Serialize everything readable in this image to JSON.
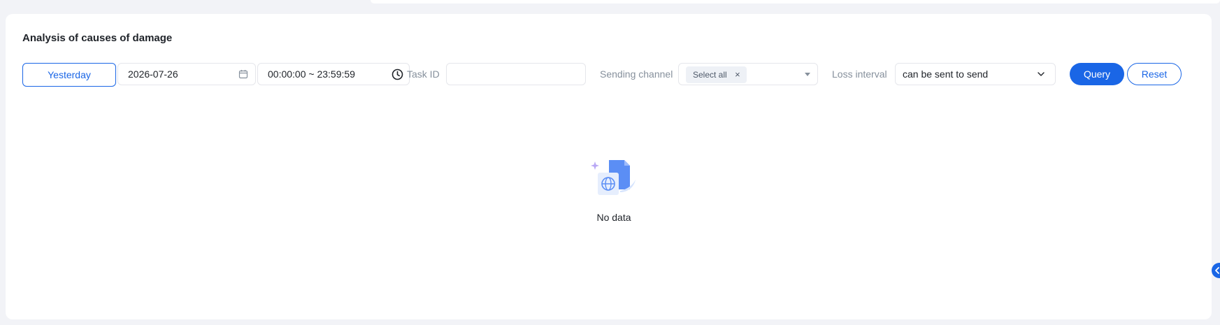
{
  "panel": {
    "title": "Analysis of causes of damage"
  },
  "filters": {
    "yesterday_label": "Yesterday",
    "date_value": "2026-07-26",
    "time_range_value": "00:00:00 ~ 23:59:59",
    "task_id_label": "Task ID",
    "task_id_value": "",
    "sending_channel_label": "Sending channel",
    "sending_channel_selected": [
      "Select all"
    ],
    "loss_interval_label": "Loss interval",
    "loss_interval_value": "can be sent to send",
    "query_label": "Query",
    "reset_label": "Reset"
  },
  "empty_state": {
    "text": "No data",
    "icon": "no-data-illustration"
  },
  "colors": {
    "accent": "#1a66e6",
    "muted_label": "#86909c",
    "border": "#e5e6eb",
    "background": "#f2f3f7"
  },
  "icons": {
    "calendar": "calendar-icon",
    "clock": "clock-icon",
    "tag_close": "close-icon",
    "dropdown": "caret-down-icon",
    "chevron": "chevron-down-icon",
    "side_handle": "chevron-left-icon"
  }
}
